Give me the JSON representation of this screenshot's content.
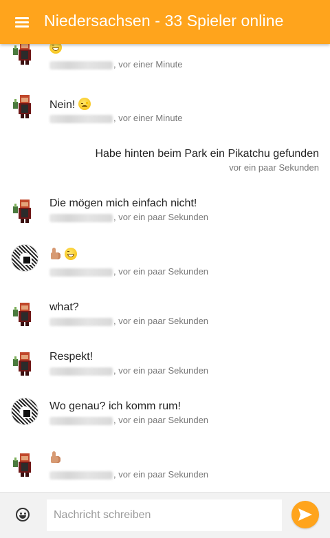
{
  "header": {
    "menu_icon": "hamburger-menu-icon",
    "title": "Niedersachsen - 33 Spieler online"
  },
  "messages": [
    {
      "type": "incoming",
      "avatar": "pixel-character-avatar",
      "text": "",
      "emojis": [
        "grinning-face"
      ],
      "time": ", vor einer Minute"
    },
    {
      "type": "incoming",
      "avatar": "pixel-character-avatar",
      "text": "Nein!",
      "emojis": [
        "disappointed-face"
      ],
      "time": ", vor einer Minute"
    },
    {
      "type": "outgoing",
      "text": "Habe hinten beim Park ein Pikatchu gefunden",
      "time": "vor ein paar Sekunden"
    },
    {
      "type": "incoming",
      "avatar": "pixel-character-avatar",
      "text": "Die mögen mich einfach nicht!",
      "time": ", vor ein paar Sekunden"
    },
    {
      "type": "incoming",
      "avatar": "qr-pattern-avatar",
      "text": "",
      "emojis": [
        "thumbs-up",
        "grinning-face"
      ],
      "time": ", vor ein paar Sekunden"
    },
    {
      "type": "incoming",
      "avatar": "pixel-character-avatar",
      "text": "what?",
      "time": ", vor ein paar Sekunden"
    },
    {
      "type": "incoming",
      "avatar": "pixel-character-avatar",
      "text": "Respekt!",
      "time": ", vor ein paar Sekunden"
    },
    {
      "type": "incoming",
      "avatar": "qr-pattern-avatar",
      "text": "Wo genau? ich komm rum!",
      "time": ", vor ein paar Sekunden"
    },
    {
      "type": "incoming",
      "avatar": "pixel-character-avatar",
      "text": "",
      "emojis": [
        "thumbs-up"
      ],
      "time": ", vor ein paar Sekunden"
    }
  ],
  "composer": {
    "emoji_icon": "smiley-icon",
    "placeholder": "Nachricht schreiben",
    "value": "",
    "send_icon": "send-icon"
  },
  "colors": {
    "accent": "#ffa41c",
    "text": "#222222",
    "meta": "#777777"
  }
}
